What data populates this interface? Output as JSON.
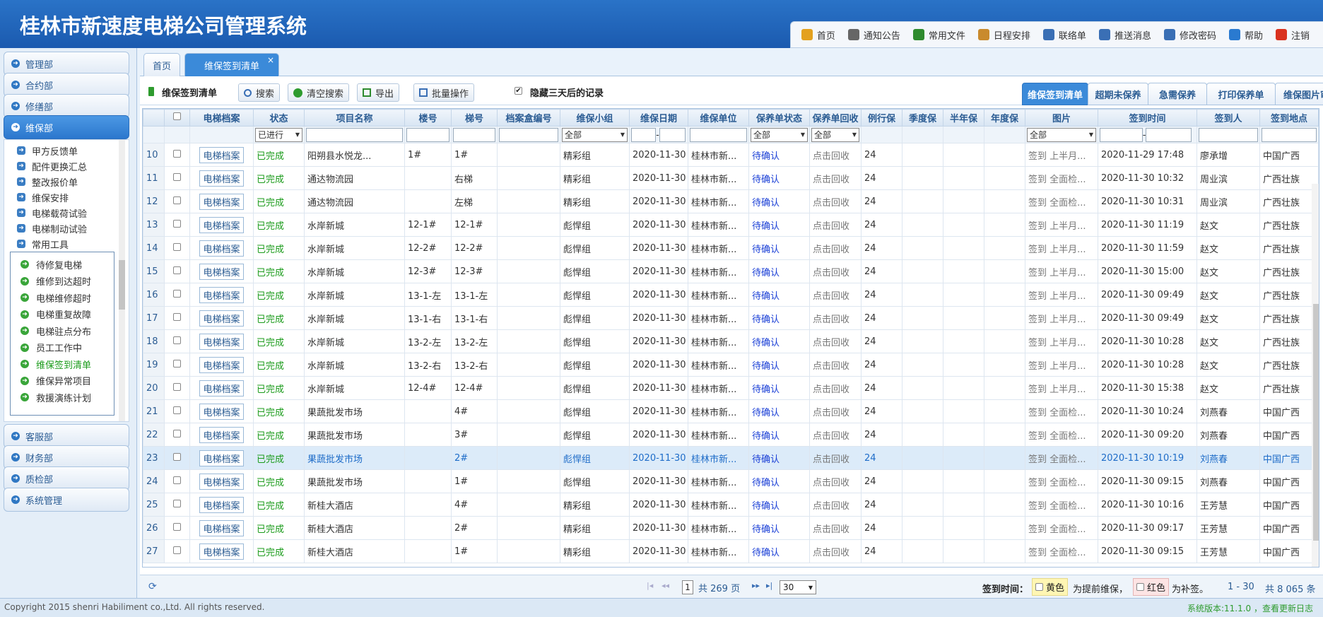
{
  "app_title": "桂林市新速度电梯公司管理系统",
  "topnav": [
    {
      "label": "首页",
      "icon": "home-icon",
      "color": "#e3a11e"
    },
    {
      "label": "通知公告",
      "icon": "gear-icon",
      "color": "#666666"
    },
    {
      "label": "常用文件",
      "icon": "file-icon",
      "color": "#2e8b2e"
    },
    {
      "label": "日程安排",
      "icon": "calendar-icon",
      "color": "#c98a2d"
    },
    {
      "label": "联络单",
      "icon": "mail-icon",
      "color": "#3a6fb5"
    },
    {
      "label": "推送消息",
      "icon": "phone-icon",
      "color": "#3a6fb5"
    },
    {
      "label": "修改密码",
      "icon": "key-icon",
      "color": "#3a6fb5"
    },
    {
      "label": "帮助",
      "icon": "help-icon",
      "color": "#2a7ad0"
    },
    {
      "label": "注销",
      "icon": "logout-icon",
      "color": "#d9321f"
    }
  ],
  "sidebar": {
    "sections": [
      "管理部",
      "合约部",
      "修缮部",
      "维保部",
      "客服部",
      "财务部",
      "质检部",
      "系统管理"
    ],
    "submenu": [
      "甲方反馈单",
      "配件更换汇总",
      "整改报价单",
      "维保安排",
      "电梯载荷试验",
      "电梯制动试验",
      "常用工具"
    ],
    "popup": [
      "待修复电梯",
      "维修到达超时",
      "电梯维修超时",
      "电梯重复故障",
      "电梯驻点分布",
      "员工工作中",
      "维保签到清单",
      "维保异常项目",
      "救援演练计划"
    ]
  },
  "tabs": {
    "home": "首页",
    "active": "维保签到清单",
    "close": "×"
  },
  "toolbar": {
    "title": "维保签到清单",
    "search": "搜索",
    "clear": "清空搜索",
    "export": "导出",
    "batch": "批量操作",
    "hide_label": "隐藏三天后的记录",
    "hide_check": "✔"
  },
  "right_tabs": [
    "维保签到清单",
    "超期未保养",
    "急需保养",
    "打印保养单",
    "维保图片审核"
  ],
  "columns": [
    "电梯档案",
    "状态",
    "项目名称",
    "楼号",
    "梯号",
    "档案盒编号",
    "维保小组",
    "维保日期",
    "维保单位",
    "保养单状态",
    "保养单回收",
    "例行保",
    "季度保",
    "半年保",
    "年度保",
    "图片",
    "签到时间",
    "签到人",
    "签到地点"
  ],
  "filters": {
    "status": "已进行",
    "group": "全部",
    "order_status": "全部",
    "recycle": "全部",
    "image": "全部"
  },
  "rows": [
    {
      "n": "10",
      "btn": "电梯档案",
      "status": "已完成",
      "project": "阳朔县水悦龙...",
      "bldg": "1#",
      "lift": "1#",
      "group": "精彩组",
      "date": "2020-11-30",
      "unit": "桂林市新...",
      "ostatus": "待确认",
      "recycle": "点击回收",
      "routine": "24",
      "img": "签到 上半月...",
      "time": "2020-11-29 17:48",
      "person": "廖承增",
      "place": "中国广西"
    },
    {
      "n": "11",
      "btn": "电梯档案",
      "status": "已完成",
      "project": "通达物流园",
      "bldg": "",
      "lift": "右梯",
      "group": "精彩组",
      "date": "2020-11-30",
      "unit": "桂林市新...",
      "ostatus": "待确认",
      "recycle": "点击回收",
      "routine": "24",
      "img": "签到 全面检...",
      "time": "2020-11-30 10:32",
      "person": "周业滨",
      "place": "广西壮族"
    },
    {
      "n": "12",
      "btn": "电梯档案",
      "status": "已完成",
      "project": "通达物流园",
      "bldg": "",
      "lift": "左梯",
      "group": "精彩组",
      "date": "2020-11-30",
      "unit": "桂林市新...",
      "ostatus": "待确认",
      "recycle": "点击回收",
      "routine": "24",
      "img": "签到 全面检...",
      "time": "2020-11-30 10:31",
      "person": "周业滨",
      "place": "广西壮族"
    },
    {
      "n": "13",
      "btn": "电梯档案",
      "status": "已完成",
      "project": "水岸新城",
      "bldg": "12-1#",
      "lift": "12-1#",
      "group": "彪悍组",
      "date": "2020-11-30",
      "unit": "桂林市新...",
      "ostatus": "待确认",
      "recycle": "点击回收",
      "routine": "24",
      "img": "签到 上半月...",
      "time": "2020-11-30 11:19",
      "person": "赵文",
      "place": "广西壮族"
    },
    {
      "n": "14",
      "btn": "电梯档案",
      "status": "已完成",
      "project": "水岸新城",
      "bldg": "12-2#",
      "lift": "12-2#",
      "group": "彪悍组",
      "date": "2020-11-30",
      "unit": "桂林市新...",
      "ostatus": "待确认",
      "recycle": "点击回收",
      "routine": "24",
      "img": "签到 上半月...",
      "time": "2020-11-30 11:59",
      "person": "赵文",
      "place": "广西壮族"
    },
    {
      "n": "15",
      "btn": "电梯档案",
      "status": "已完成",
      "project": "水岸新城",
      "bldg": "12-3#",
      "lift": "12-3#",
      "group": "彪悍组",
      "date": "2020-11-30",
      "unit": "桂林市新...",
      "ostatus": "待确认",
      "recycle": "点击回收",
      "routine": "24",
      "img": "签到 上半月...",
      "time": "2020-11-30 15:00",
      "person": "赵文",
      "place": "广西壮族"
    },
    {
      "n": "16",
      "btn": "电梯档案",
      "status": "已完成",
      "project": "水岸新城",
      "bldg": "13-1-左",
      "lift": "13-1-左",
      "group": "彪悍组",
      "date": "2020-11-30",
      "unit": "桂林市新...",
      "ostatus": "待确认",
      "recycle": "点击回收",
      "routine": "24",
      "img": "签到 上半月...",
      "time": "2020-11-30 09:49",
      "person": "赵文",
      "place": "广西壮族"
    },
    {
      "n": "17",
      "btn": "电梯档案",
      "status": "已完成",
      "project": "水岸新城",
      "bldg": "13-1-右",
      "lift": "13-1-右",
      "group": "彪悍组",
      "date": "2020-11-30",
      "unit": "桂林市新...",
      "ostatus": "待确认",
      "recycle": "点击回收",
      "routine": "24",
      "img": "签到 上半月...",
      "time": "2020-11-30 09:49",
      "person": "赵文",
      "place": "广西壮族"
    },
    {
      "n": "18",
      "btn": "电梯档案",
      "status": "已完成",
      "project": "水岸新城",
      "bldg": "13-2-左",
      "lift": "13-2-左",
      "group": "彪悍组",
      "date": "2020-11-30",
      "unit": "桂林市新...",
      "ostatus": "待确认",
      "recycle": "点击回收",
      "routine": "24",
      "img": "签到 上半月...",
      "time": "2020-11-30 10:28",
      "person": "赵文",
      "place": "广西壮族"
    },
    {
      "n": "19",
      "btn": "电梯档案",
      "status": "已完成",
      "project": "水岸新城",
      "bldg": "13-2-右",
      "lift": "13-2-右",
      "group": "彪悍组",
      "date": "2020-11-30",
      "unit": "桂林市新...",
      "ostatus": "待确认",
      "recycle": "点击回收",
      "routine": "24",
      "img": "签到 上半月...",
      "time": "2020-11-30 10:28",
      "person": "赵文",
      "place": "广西壮族"
    },
    {
      "n": "20",
      "btn": "电梯档案",
      "status": "已完成",
      "project": "水岸新城",
      "bldg": "12-4#",
      "lift": "12-4#",
      "group": "彪悍组",
      "date": "2020-11-30",
      "unit": "桂林市新...",
      "ostatus": "待确认",
      "recycle": "点击回收",
      "routine": "24",
      "img": "签到 上半月...",
      "time": "2020-11-30 15:38",
      "person": "赵文",
      "place": "广西壮族"
    },
    {
      "n": "21",
      "btn": "电梯档案",
      "status": "已完成",
      "project": "果蔬批发市场",
      "bldg": "",
      "lift": "4#",
      "group": "彪悍组",
      "date": "2020-11-30",
      "unit": "桂林市新...",
      "ostatus": "待确认",
      "recycle": "点击回收",
      "routine": "24",
      "img": "签到 全面检...",
      "time": "2020-11-30 10:24",
      "person": "刘燕春",
      "place": "中国广西"
    },
    {
      "n": "22",
      "btn": "电梯档案",
      "status": "已完成",
      "project": "果蔬批发市场",
      "bldg": "",
      "lift": "3#",
      "group": "彪悍组",
      "date": "2020-11-30",
      "unit": "桂林市新...",
      "ostatus": "待确认",
      "recycle": "点击回收",
      "routine": "24",
      "img": "签到 全面检...",
      "time": "2020-11-30 09:20",
      "person": "刘燕春",
      "place": "中国广西"
    },
    {
      "n": "23",
      "btn": "电梯档案",
      "status": "已完成",
      "project": "果蔬批发市场",
      "bldg": "",
      "lift": "2#",
      "group": "彪悍组",
      "date": "2020-11-30",
      "unit": "桂林市新...",
      "ostatus": "待确认",
      "recycle": "点击回收",
      "routine": "24",
      "img": "签到 全面检...",
      "time": "2020-11-30 10:19",
      "person": "刘燕春",
      "place": "中国广西"
    },
    {
      "n": "24",
      "btn": "电梯档案",
      "status": "已完成",
      "project": "果蔬批发市场",
      "bldg": "",
      "lift": "1#",
      "group": "彪悍组",
      "date": "2020-11-30",
      "unit": "桂林市新...",
      "ostatus": "待确认",
      "recycle": "点击回收",
      "routine": "24",
      "img": "签到 全面检...",
      "time": "2020-11-30 09:15",
      "person": "刘燕春",
      "place": "中国广西"
    },
    {
      "n": "25",
      "btn": "电梯档案",
      "status": "已完成",
      "project": "新桂大酒店",
      "bldg": "",
      "lift": "4#",
      "group": "精彩组",
      "date": "2020-11-30",
      "unit": "桂林市新...",
      "ostatus": "待确认",
      "recycle": "点击回收",
      "routine": "24",
      "img": "签到 全面检...",
      "time": "2020-11-30 10:16",
      "person": "王芳慧",
      "place": "中国广西"
    },
    {
      "n": "26",
      "btn": "电梯档案",
      "status": "已完成",
      "project": "新桂大酒店",
      "bldg": "",
      "lift": "2#",
      "group": "精彩组",
      "date": "2020-11-30",
      "unit": "桂林市新...",
      "ostatus": "待确认",
      "recycle": "点击回收",
      "routine": "24",
      "img": "签到 全面检...",
      "time": "2020-11-30 09:17",
      "person": "王芳慧",
      "place": "中国广西"
    },
    {
      "n": "27",
      "btn": "电梯档案",
      "status": "已完成",
      "project": "新桂大酒店",
      "bldg": "",
      "lift": "1#",
      "group": "精彩组",
      "date": "2020-11-30",
      "unit": "桂林市新...",
      "ostatus": "待确认",
      "recycle": "点击回收",
      "routine": "24",
      "img": "签到 全面检...",
      "time": "2020-11-30 09:15",
      "person": "王芳慧",
      "place": "中国广西"
    }
  ],
  "pager": {
    "page": "1",
    "total_pages": "共 269 页",
    "per_page": "30",
    "legend_label": "签到时间：",
    "yellow": "黄色",
    "yellow_desc": "为提前维保，",
    "red": "红色",
    "red_desc": "为补签。",
    "range": "1 - 30",
    "total": "共 8 065 条"
  },
  "footer": {
    "copyright": "Copyright 2015 shenri Habiliment co.,Ltd. All rights reserved.",
    "version": "系统版本:11.1.0 ，查看更新日志"
  }
}
